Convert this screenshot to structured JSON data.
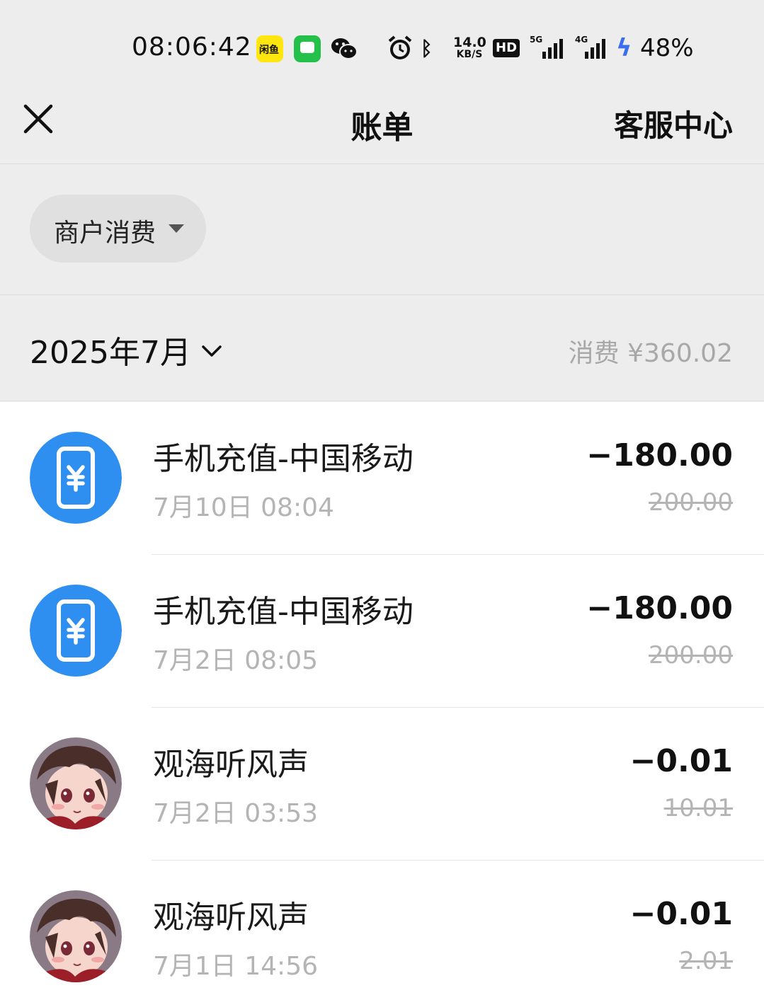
{
  "status_bar": {
    "time": "08:06:42",
    "xianyu_label": "闲鱼",
    "speed_value": "14.0",
    "speed_unit": "KB/S",
    "hd_label": "HD",
    "signal_1_label": "5G",
    "signal_2_label": "4G",
    "battery": "48%",
    "icons": [
      "xianyu-app-icon",
      "messages-app-icon",
      "wechat-app-icon",
      "alarm-icon",
      "bluetooth-icon",
      "hd-icon",
      "signal-5g-icon",
      "signal-4g-icon",
      "charging-icon"
    ]
  },
  "nav": {
    "title": "账单",
    "right_link": "客服中心",
    "close_icon": "close-icon"
  },
  "filter": {
    "label": "商户消费"
  },
  "month": {
    "label": "2025年7月",
    "total": "消费 ¥360.02"
  },
  "transactions": [
    {
      "title": "手机充值-中国移动",
      "time": "7月10日 08:04",
      "amount": "−180.00",
      "original": "200.00",
      "avatar": "phone-recharge-icon"
    },
    {
      "title": "手机充值-中国移动",
      "time": "7月2日 08:05",
      "amount": "−180.00",
      "original": "200.00",
      "avatar": "phone-recharge-icon"
    },
    {
      "title": "观海听风声",
      "time": "7月2日 03:53",
      "amount": "−0.01",
      "original": "10.01",
      "avatar": "user-avatar"
    },
    {
      "title": "观海听风声",
      "time": "7月1日 14:56",
      "amount": "−0.01",
      "original": "2.01",
      "avatar": "user-avatar"
    }
  ],
  "colors": {
    "background": "#ededed",
    "list_background": "#ffffff",
    "recharge_blue": "#2f8ff0",
    "muted_text": "#b4b4b4"
  }
}
